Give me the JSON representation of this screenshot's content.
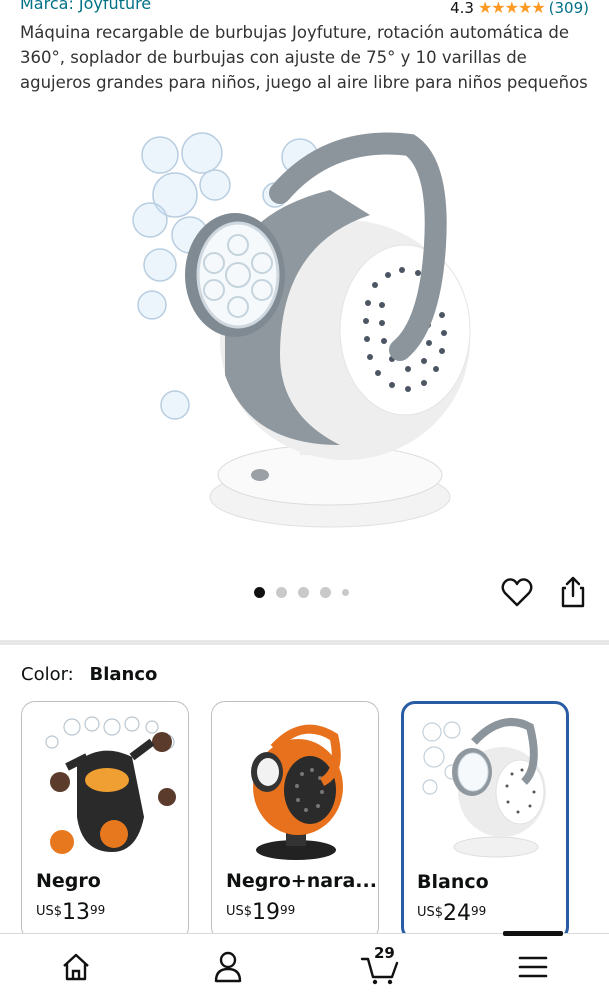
{
  "header": {
    "brand": "Marca: Joyfuture",
    "rating_value": "4.3",
    "rating_stars": "★★★★★",
    "rating_count": "(309)"
  },
  "product": {
    "title": "Máquina recargable de burbujas Joyfuture, rotación automática de 360°, soplador de burbujas con ajuste de 75° y 10 varillas de agujeros grandes para niños, juego al aire libre para niños pequeños"
  },
  "gallery": {
    "image_count": 5,
    "active_index": 0
  },
  "actions": {
    "wishlist_icon": "heart-icon",
    "share_icon": "share-icon"
  },
  "color_selector": {
    "label": "Color:",
    "selected": "Blanco",
    "variants": [
      {
        "name": "Negro",
        "currency": "US$",
        "whole": "13",
        "cents": "99"
      },
      {
        "name": "Negro+nara...",
        "currency": "US$",
        "whole": "19",
        "cents": "99"
      },
      {
        "name": "Blanco",
        "currency": "US$",
        "whole": "24",
        "cents": "99"
      }
    ]
  },
  "bottom_nav": {
    "items": [
      "home-icon",
      "account-icon",
      "cart-icon",
      "menu-icon"
    ],
    "cart_count": "29"
  },
  "colors": {
    "link": "#007185",
    "star": "#ff9a24",
    "selected_border": "#2a5ca3"
  }
}
